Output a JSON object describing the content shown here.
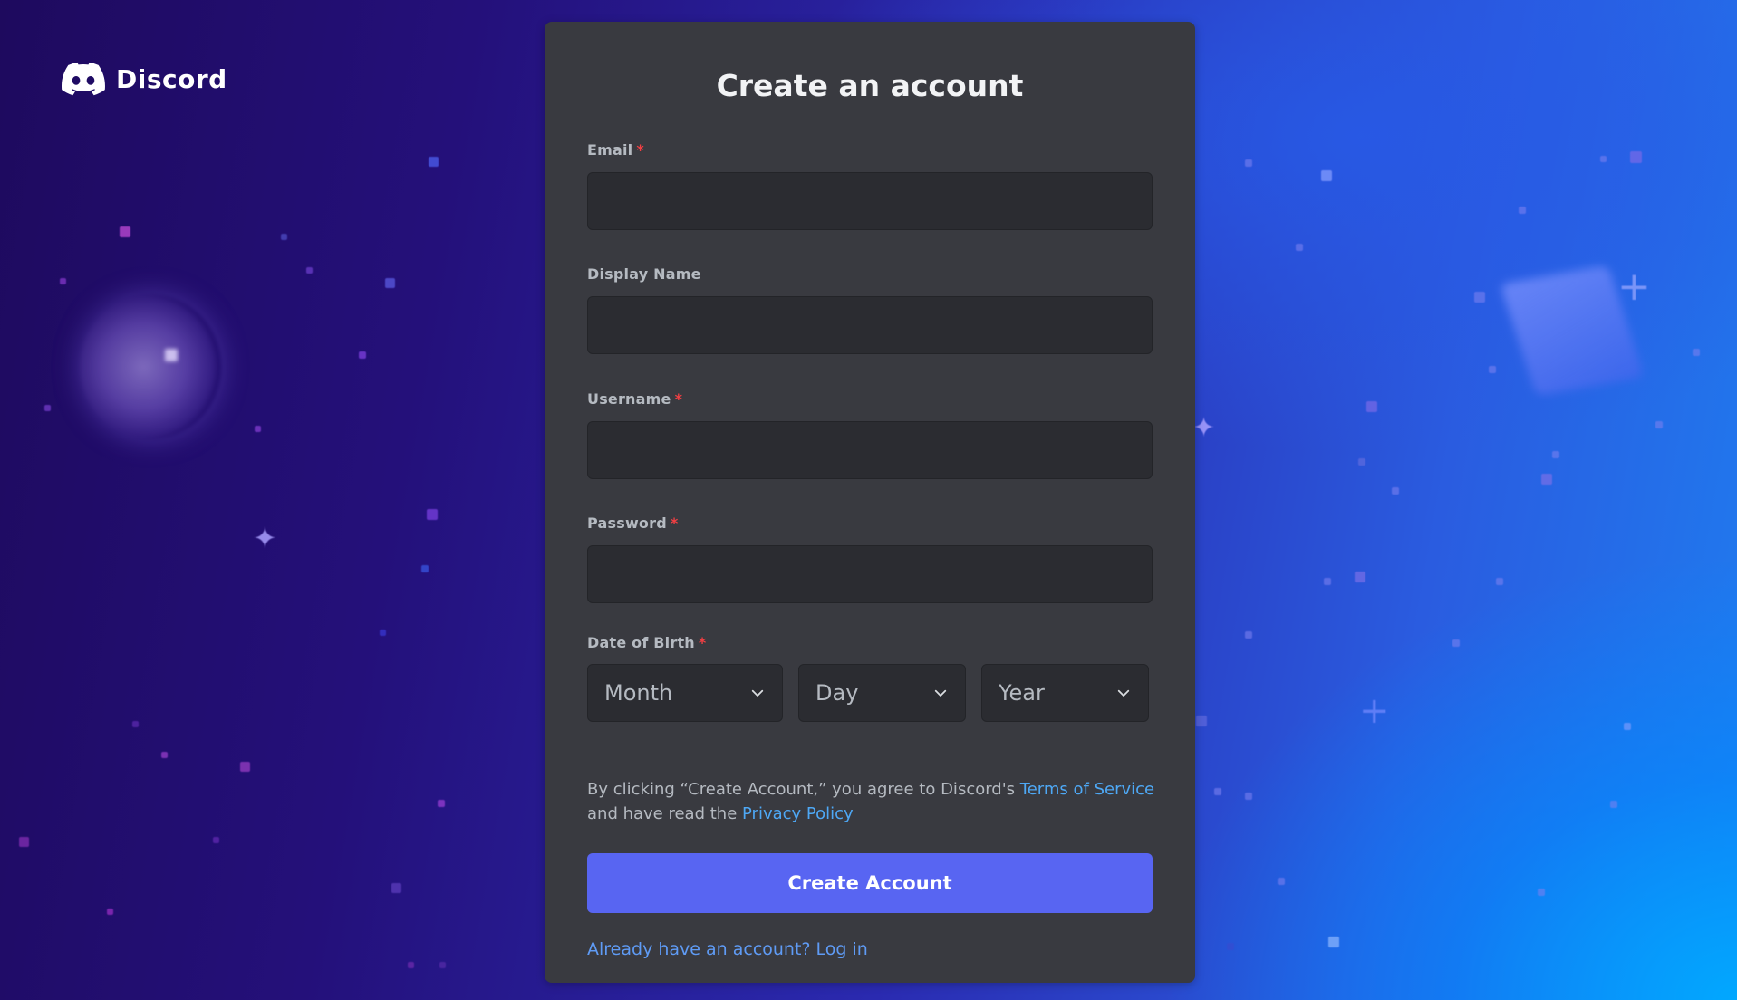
{
  "brand": {
    "name": "Discord",
    "accent_color": "#5865F2",
    "link_color": "#00A8FC"
  },
  "form": {
    "title": "Create an account",
    "email": {
      "label": "Email",
      "required_marker": "*",
      "value": "",
      "placeholder": ""
    },
    "display_name": {
      "label": "Display Name",
      "value": "",
      "placeholder": ""
    },
    "username": {
      "label": "Username",
      "required_marker": "*",
      "value": "",
      "placeholder": ""
    },
    "password": {
      "label": "Password",
      "required_marker": "*",
      "value": "",
      "placeholder": ""
    },
    "date_of_birth": {
      "label": "Date of Birth",
      "required_marker": "*",
      "month": "Month",
      "day": "Day",
      "year": "Year"
    },
    "terms": {
      "prefix": "By clicking “Create Account,” you agree to Discord's ",
      "tos_link": "Terms of Service",
      "middle": " and have read the ",
      "privacy_link": "Privacy Policy"
    },
    "submit_label": "Create Account",
    "login_link": "Already have an account? Log in"
  }
}
